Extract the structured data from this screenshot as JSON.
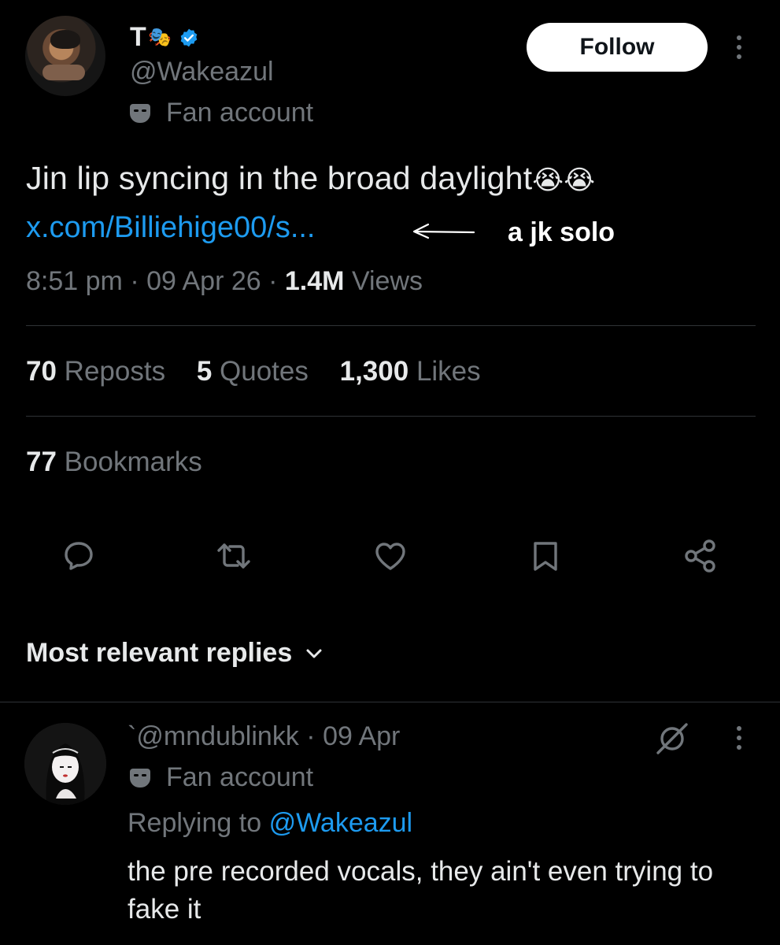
{
  "post": {
    "author": {
      "display_name": "T",
      "name_emoji": "🎭",
      "handle": "@Wakeazul",
      "account_label": "Fan account"
    },
    "follow_label": "Follow",
    "text": "Jin lip syncing in the broad daylight",
    "text_emoji": "😭😭",
    "link_text": "x.com/Billiehige00/s...",
    "annotation": "a jk solo",
    "time": "8:51 pm",
    "separator": "·",
    "date": "09 Apr 26",
    "views_count": "1.4M",
    "views_label": "Views",
    "reposts_count": "70",
    "reposts_label": "Reposts",
    "quotes_count": "5",
    "quotes_label": "Quotes",
    "likes_count": "1,300",
    "likes_label": "Likes",
    "bookmarks_count": "77",
    "bookmarks_label": "Bookmarks",
    "actions": [
      "reply-icon",
      "repost-icon",
      "like-icon",
      "bookmark-icon",
      "share-icon"
    ]
  },
  "replies": {
    "sort_label": "Most relevant replies",
    "items": [
      {
        "prefix": "`",
        "handle": "@mndublinkk",
        "separator": "·",
        "date": "09 Apr",
        "account_label": "Fan account",
        "replying_prefix": "Replying to",
        "replying_handle": "@Wakeazul",
        "text": "the pre recorded vocals, they ain't even trying to fake it"
      }
    ]
  },
  "colors": {
    "background": "#000000",
    "text": "#e7e9ea",
    "muted": "#71767b",
    "link": "#1d9bf0",
    "divider": "#2f3336"
  }
}
